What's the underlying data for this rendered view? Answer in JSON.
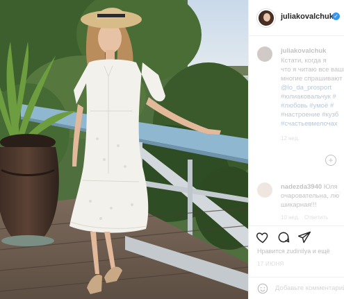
{
  "post": {
    "author": "juliakovalchuk",
    "verified_icon": "verified-badge-icon"
  },
  "comments": [
    {
      "author": "juliakovalchuk",
      "lines": [
        "Кстати, когда я",
        "что я читаю все ваши",
        "многие спрашивают",
        "@lo_da_prosport",
        "#юлиаковальчук #",
        "#любовь #умоё #",
        "#настроение #кузб",
        "#счастьевмелочах"
      ],
      "time": "12 нед."
    },
    {
      "author": "nadezda3940",
      "lines": [
        "Юля",
        "очаровательна, лю",
        "шикарная!!!"
      ],
      "time": "10 нед.",
      "reply_label": "Ответить"
    }
  ],
  "actions": {
    "like_icon": "heart-icon",
    "comment_icon": "comment-icon",
    "share_icon": "share-icon"
  },
  "likes_text": "Нравится zudinilya и ещё",
  "date_text": "17 ИЮНЯ",
  "add_comment": {
    "emoji_icon": "smile-icon",
    "placeholder": "Добавьте комментарий..."
  }
}
